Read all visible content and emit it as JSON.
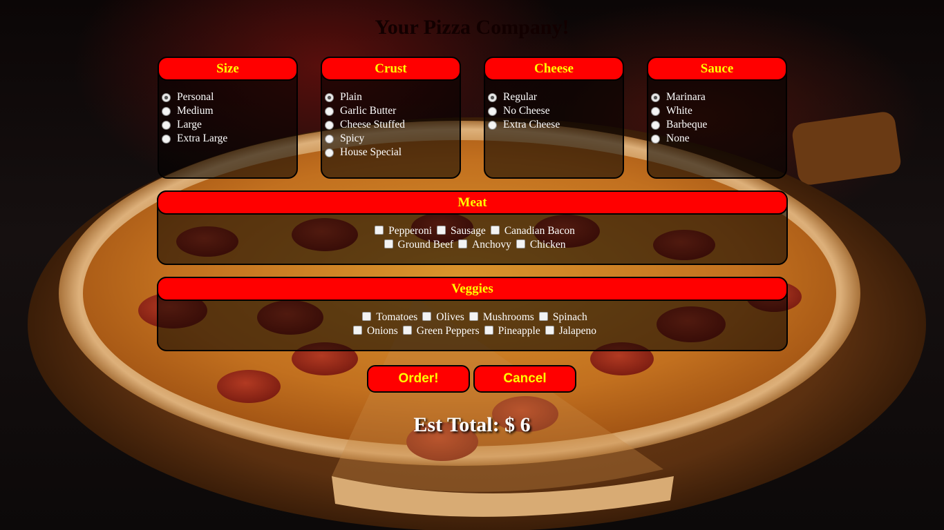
{
  "title": "Your Pizza Company!",
  "size": {
    "heading": "Size",
    "options": [
      "Personal",
      "Medium",
      "Large",
      "Extra Large"
    ],
    "selected": "Personal"
  },
  "crust": {
    "heading": "Crust",
    "options": [
      "Plain",
      "Garlic Butter",
      "Cheese Stuffed",
      "Spicy",
      "House Special"
    ],
    "selected": "Plain"
  },
  "cheese": {
    "heading": "Cheese",
    "options": [
      "Regular",
      "No Cheese",
      "Extra Cheese"
    ],
    "selected": "Regular"
  },
  "sauce": {
    "heading": "Sauce",
    "options": [
      "Marinara",
      "White",
      "Barbeque",
      "None"
    ],
    "selected": "Marinara"
  },
  "meat": {
    "heading": "Meat",
    "row1": [
      "Pepperoni",
      "Sausage",
      "Canadian Bacon"
    ],
    "row2": [
      "Ground Beef",
      "Anchovy",
      "Chicken"
    ]
  },
  "veggies": {
    "heading": "Veggies",
    "row1": [
      "Tomatoes",
      "Olives",
      "Mushrooms",
      "Spinach"
    ],
    "row2": [
      "Onions",
      "Green Peppers",
      "Pineapple",
      "Jalapeno"
    ]
  },
  "buttons": {
    "order": "Order!",
    "cancel": "Cancel"
  },
  "total": "Est Total: $ 6",
  "colors": {
    "accent": "#ff0000",
    "heading_text": "#ffff00",
    "panel_border": "#000000"
  }
}
